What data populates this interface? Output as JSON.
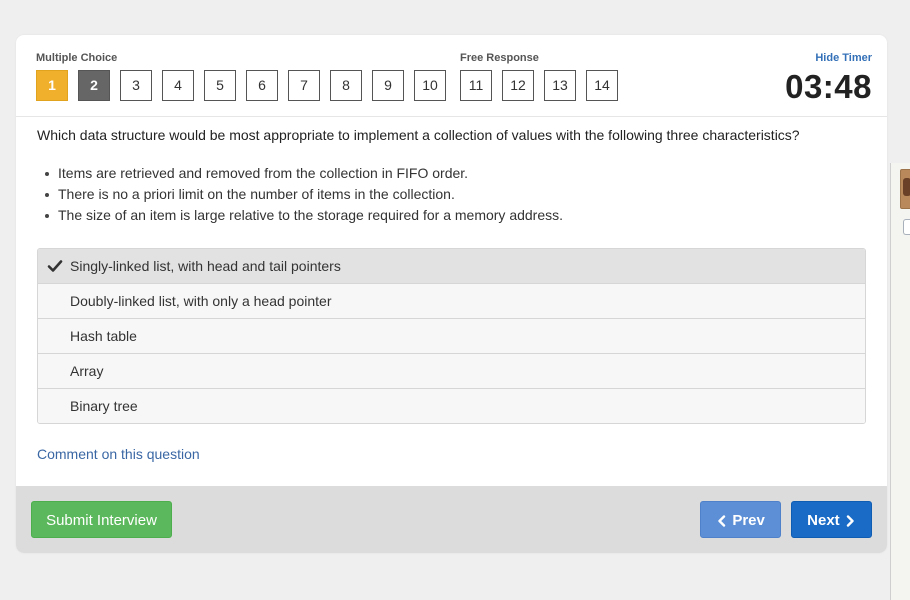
{
  "header": {
    "multiple_choice_label": "Multiple Choice",
    "free_response_label": "Free Response",
    "hide_timer_label": "Hide Timer",
    "timer": "03:48",
    "question_numbers": [
      "1",
      "2",
      "3",
      "4",
      "5",
      "6",
      "7",
      "8",
      "9",
      "10",
      "11",
      "12",
      "13",
      "14"
    ],
    "current_question": "1",
    "answered_question": "2"
  },
  "question": {
    "text": "Which data structure would be most appropriate to implement a collection of values with the following three characteristics?",
    "bullets": [
      "Items are retrieved and removed from the collection in FIFO order.",
      "There is no a priori limit on the number of items in the collection.",
      "The size of an item is large relative to the storage required for a memory address."
    ]
  },
  "options": [
    {
      "label": "Singly-linked list, with head and tail pointers",
      "selected": true
    },
    {
      "label": "Doubly-linked list, with only a head pointer",
      "selected": false
    },
    {
      "label": "Hash table",
      "selected": false
    },
    {
      "label": "Array",
      "selected": false
    },
    {
      "label": "Binary tree",
      "selected": false
    }
  ],
  "comment_link": "Comment on this question",
  "footer": {
    "submit_label": "Submit Interview",
    "prev_label": "Prev",
    "next_label": "Next"
  },
  "colors": {
    "current_question": "#f0b02c",
    "answered_question": "#666666",
    "submit_button": "#5cb85c",
    "prev_button": "#5c8fd6",
    "next_button": "#1a6bc6",
    "link": "#3a67a4"
  },
  "icons": {
    "check": "check-icon",
    "prev": "chevron-left-icon",
    "next": "chevron-right-icon"
  }
}
